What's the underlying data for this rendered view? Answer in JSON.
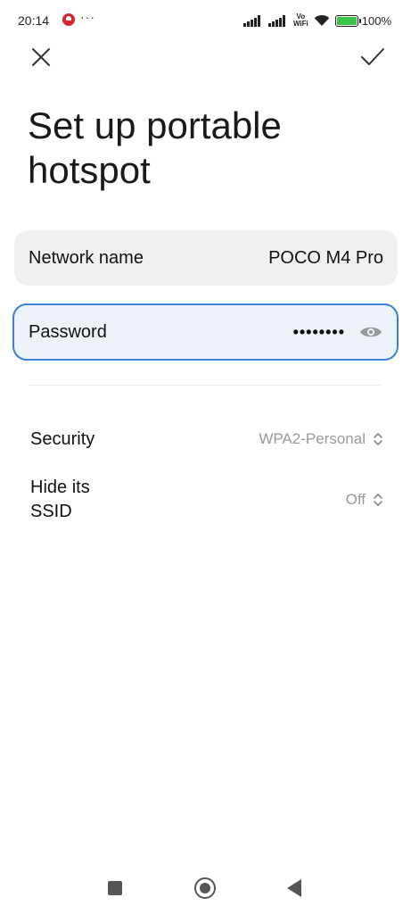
{
  "status_bar": {
    "time": "20:14",
    "more": "···",
    "volte": "Vo\nWiFi",
    "battery_percent": "100%",
    "battery_color": "#3ac54a",
    "icons": [
      "notification-icon",
      "signal-icon",
      "signal-icon",
      "vowifi-icon",
      "wifi-icon",
      "battery-icon"
    ]
  },
  "header": {
    "close_icon": "close-icon",
    "confirm_icon": "check-icon",
    "title": "Set up portable hotspot"
  },
  "form": {
    "network_name": {
      "label": "Network name",
      "value": "POCO M4 Pro"
    },
    "password": {
      "label": "Password",
      "value": "••••••••",
      "toggle_icon": "eye-icon"
    },
    "security": {
      "label": "Security",
      "value": "WPA2-Personal"
    },
    "hide_ssid": {
      "label": "Hide its SSID",
      "value": "Off"
    }
  },
  "accent_color": "#3b82d9",
  "nav_bar": {
    "icons": [
      "recents-icon",
      "home-icon",
      "back-icon"
    ]
  }
}
